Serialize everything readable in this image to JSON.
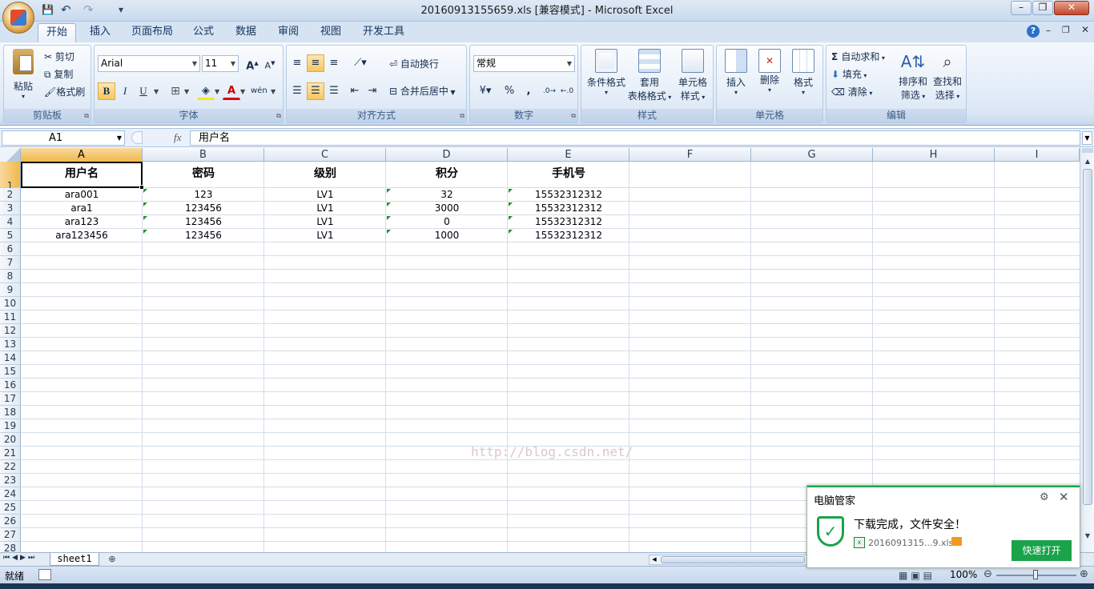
{
  "window": {
    "title": "20160913155659.xls  [兼容模式] - Microsoft Excel",
    "controls": {
      "minimize": "–",
      "restore": "❐",
      "close": "✕"
    }
  },
  "quick_access": {
    "save": "💾",
    "undo": "↶",
    "redo": "↷",
    "customize": "▾"
  },
  "tabs": [
    "开始",
    "插入",
    "页面布局",
    "公式",
    "数据",
    "审阅",
    "视图",
    "开发工具"
  ],
  "active_tab": "开始",
  "ribbon_right": {
    "help": "?",
    "min": "–",
    "restore": "❐",
    "close": "✕"
  },
  "ribbon": {
    "clipboard": {
      "label": "剪贴板",
      "paste": "粘贴",
      "cut": "剪切",
      "copy": "复制",
      "format_painter": "格式刷"
    },
    "font": {
      "label": "字体",
      "font_name": "Arial",
      "font_size": "11",
      "grow": "A",
      "shrink": "A",
      "bold": "B",
      "italic": "I",
      "underline": "U"
    },
    "alignment": {
      "label": "对齐方式",
      "wrap": "自动换行",
      "merge": "合并后居中"
    },
    "number": {
      "label": "数字",
      "format": "常规",
      "percent": "%",
      "comma": ","
    },
    "styles": {
      "label": "样式",
      "conditional": "条件格式",
      "table_fmt_1": "套用",
      "table_fmt_2": "表格格式",
      "cell_style_1": "单元格",
      "cell_style_2": "样式"
    },
    "cells": {
      "label": "单元格",
      "insert": "插入",
      "delete": "删除",
      "format": "格式"
    },
    "editing": {
      "label": "编辑",
      "autosum": "自动求和",
      "fill": "填充",
      "clear": "清除",
      "sort_1": "排序和",
      "sort_2": "筛选",
      "find_1": "查找和",
      "find_2": "选择"
    }
  },
  "formula_bar": {
    "name_box": "A1",
    "fx": "fx",
    "content": "用户名"
  },
  "columns": [
    "A",
    "B",
    "C",
    "D",
    "E",
    "F",
    "G",
    "H",
    "I"
  ],
  "selected_column": "A",
  "rows": [
    "1",
    "2",
    "3",
    "4",
    "5",
    "6",
    "7",
    "8",
    "9",
    "10",
    "11",
    "12",
    "13",
    "14",
    "15",
    "16",
    "17",
    "18",
    "19",
    "20",
    "21",
    "22",
    "23",
    "24",
    "25",
    "26",
    "27",
    "28"
  ],
  "selected_row": "1",
  "table": {
    "headers": [
      "用户名",
      "密码",
      "级别",
      "积分",
      "手机号"
    ],
    "data": [
      [
        "ara001",
        "123",
        "LV1",
        "32",
        "15532312312"
      ],
      [
        "ara1",
        "123456",
        "LV1",
        "3000",
        "15532312312"
      ],
      [
        "ara123",
        "123456",
        "LV1",
        "0",
        "15532312312"
      ],
      [
        "ara123456",
        "123456",
        "LV1",
        "1000",
        "15532312312"
      ]
    ]
  },
  "watermark": "http://blog.csdn.net/",
  "sheet_tabs": [
    "sheet1"
  ],
  "status": {
    "ready": "就绪",
    "zoom": "100%"
  },
  "popup": {
    "app": "电脑管家",
    "message": "下载完成，文件安全！",
    "file": "2016091315...9.xls",
    "open_button": "快速打开"
  },
  "colors": {
    "accent": "#f1b84a",
    "ribbon": "#dbe7f5",
    "popup_green": "#1aa34a"
  }
}
